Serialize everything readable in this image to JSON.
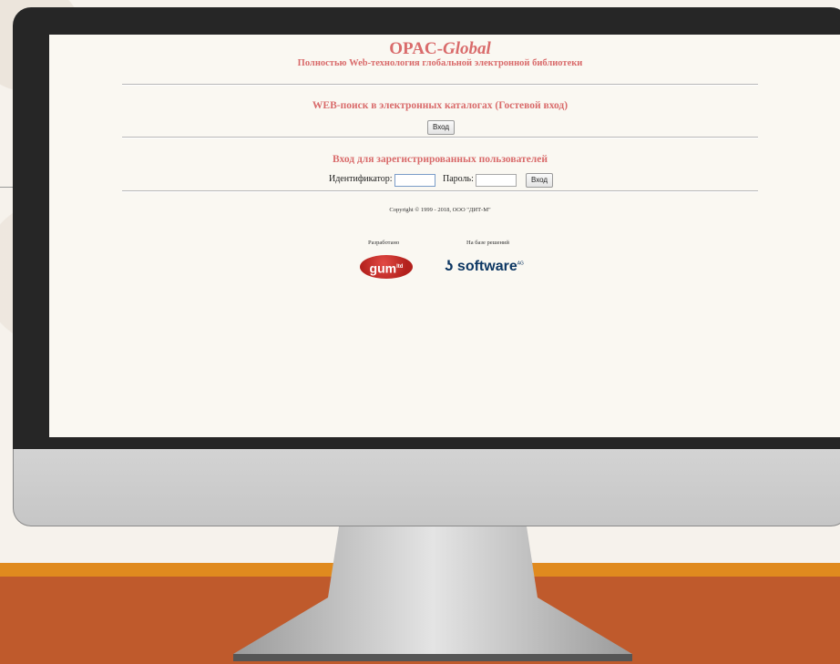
{
  "screen": {
    "title_main": "OPAC-",
    "title_italic": "Global",
    "subtitle": "Полностью Web-технология глобальной электронной библиотеки",
    "guest_heading": "WEB-поиск в электронных каталогах (Гостевой вход)",
    "guest_button": "Вход",
    "registered_heading": "Вход для зарегистрированных пользователей",
    "login_label": "Идентификатор:",
    "login_value": "",
    "password_label": "Пароль:",
    "password_value": "",
    "login_button": "Вход",
    "copyright": "Copyright © 1999 - 2018, ООО \"ДИТ-М\"",
    "developed_by_label": "Разработано",
    "based_on_label": "На базе решений",
    "developer_logo_text": "gum",
    "developer_logo_mark": "ltd",
    "partner_logo_mark": "ʖ",
    "partner_logo_text": "software",
    "partner_logo_suffix": "AG"
  },
  "colors": {
    "accent_heading": "#d96b6b",
    "monitor_bezel": "#262626",
    "floor": "#bf5a2c",
    "stripe": "#e08a1e"
  }
}
